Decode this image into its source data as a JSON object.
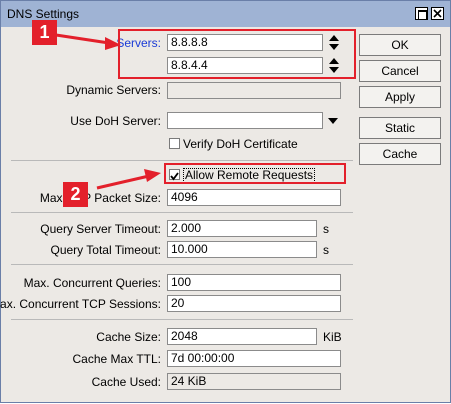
{
  "window": {
    "title": "DNS Settings"
  },
  "servers": {
    "label": "Servers:",
    "values": [
      "8.8.8.8",
      "8.8.4.4"
    ]
  },
  "dynamic_servers": {
    "label": "Dynamic Servers:",
    "value": ""
  },
  "doh": {
    "label": "Use DoH Server:",
    "value": "",
    "verify_label": "Verify DoH Certificate",
    "verify_checked": false
  },
  "allow_remote": {
    "label": "Allow Remote Requests",
    "checked": true
  },
  "max_udp": {
    "label": "Max UDP Packet Size:",
    "value": "4096"
  },
  "query_server_timeout": {
    "label": "Query Server Timeout:",
    "value": "2.000",
    "unit": "s"
  },
  "query_total_timeout": {
    "label": "Query Total Timeout:",
    "value": "10.000",
    "unit": "s"
  },
  "max_concurrent_queries": {
    "label": "Max. Concurrent Queries:",
    "value": "100"
  },
  "max_concurrent_tcp": {
    "label": "Max. Concurrent TCP Sessions:",
    "value": "20"
  },
  "cache_size": {
    "label": "Cache Size:",
    "value": "2048",
    "unit": "KiB"
  },
  "cache_max_ttl": {
    "label": "Cache Max TTL:",
    "value": "7d 00:00:00"
  },
  "cache_used": {
    "label": "Cache Used:",
    "value": "24 KiB"
  },
  "buttons": {
    "ok": "OK",
    "cancel": "Cancel",
    "apply": "Apply",
    "static": "Static",
    "cache": "Cache"
  },
  "annotations": {
    "badge1": "1",
    "badge2": "2",
    "color": "#e3202b"
  }
}
